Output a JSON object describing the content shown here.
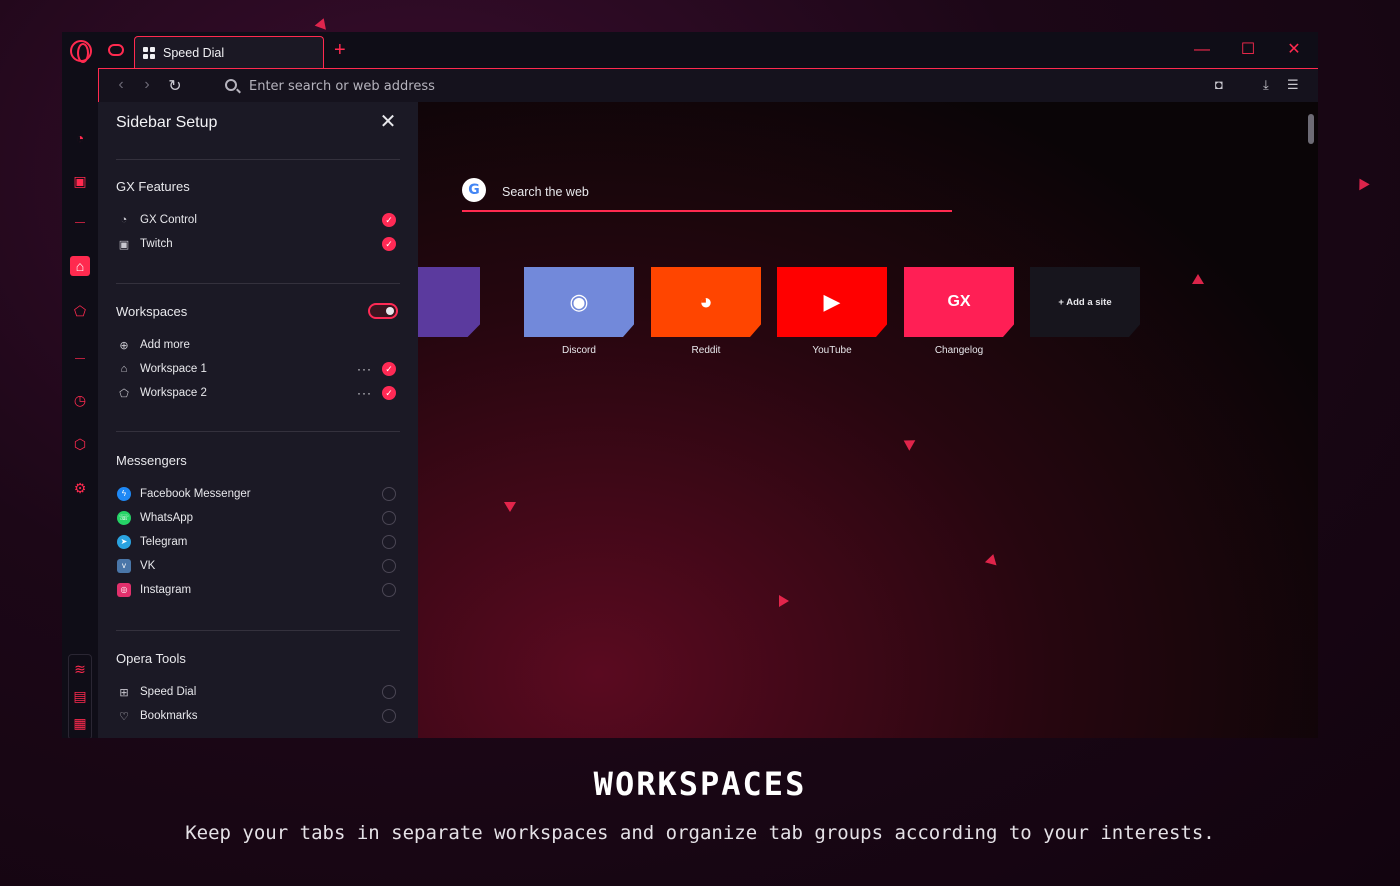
{
  "window": {
    "tab_title": "Speed Dial",
    "new_tab": "+",
    "controls": {
      "minimize": "—",
      "maximize": "☐",
      "close": "✕"
    }
  },
  "addressbar": {
    "placeholder": "Enter search or web address",
    "icons": [
      "back-icon",
      "forward-icon",
      "reload-icon",
      "search-icon",
      "camera-icon",
      "download-icon",
      "settings-sliders-icon"
    ]
  },
  "rail": {
    "icons": [
      "gx-control-icon",
      "twitch-icon",
      "workspace-1-icon",
      "workspace-2-icon",
      "history-icon",
      "extensions-icon",
      "settings-icon",
      "wifi-icon",
      "storage-icon",
      "cpu-icon",
      "more-icon"
    ],
    "more": "⋯"
  },
  "sidebar_setup": {
    "title": "Sidebar Setup",
    "close": "✕",
    "gx_features": {
      "title": "GX Features",
      "items": [
        {
          "label": "GX Control",
          "checked": true
        },
        {
          "label": "Twitch",
          "checked": true
        }
      ]
    },
    "workspaces": {
      "title": "Workspaces",
      "enabled": true,
      "add_more": "Add more",
      "items": [
        {
          "label": "Workspace 1",
          "checked": true,
          "more": "···"
        },
        {
          "label": "Workspace 2",
          "checked": true,
          "more": "···"
        }
      ]
    },
    "messengers": {
      "title": "Messengers",
      "items": [
        {
          "label": "Facebook Messenger",
          "checked": false
        },
        {
          "label": "WhatsApp",
          "checked": false
        },
        {
          "label": "Telegram",
          "checked": false
        },
        {
          "label": "VK",
          "checked": false
        },
        {
          "label": "Instagram",
          "checked": false
        }
      ]
    },
    "opera_tools": {
      "title": "Opera Tools",
      "items": [
        {
          "label": "Speed Dial",
          "checked": false
        },
        {
          "label": "Bookmarks",
          "checked": false
        }
      ]
    }
  },
  "speed_dial": {
    "search_placeholder": "Search the web",
    "google_glyph": "G",
    "tiles": [
      {
        "label": "Discord",
        "color": "#7289da",
        "glyph": "◉"
      },
      {
        "label": "Reddit",
        "color": "#ff4500",
        "glyph": "◕"
      },
      {
        "label": "YouTube",
        "color": "#ff0000",
        "glyph": "▶"
      },
      {
        "label": "Changelog",
        "color": "#ff1f55",
        "glyph": "GX"
      }
    ],
    "add_site": "+ Add a site"
  },
  "caption": {
    "headline": "WORKSPACES",
    "tagline": "Keep your tabs in separate workspaces and organize tab groups according to your interests."
  },
  "colors": {
    "accent": "#ff2a4f",
    "panel": "#1b1925",
    "window": "#0d0b14"
  }
}
